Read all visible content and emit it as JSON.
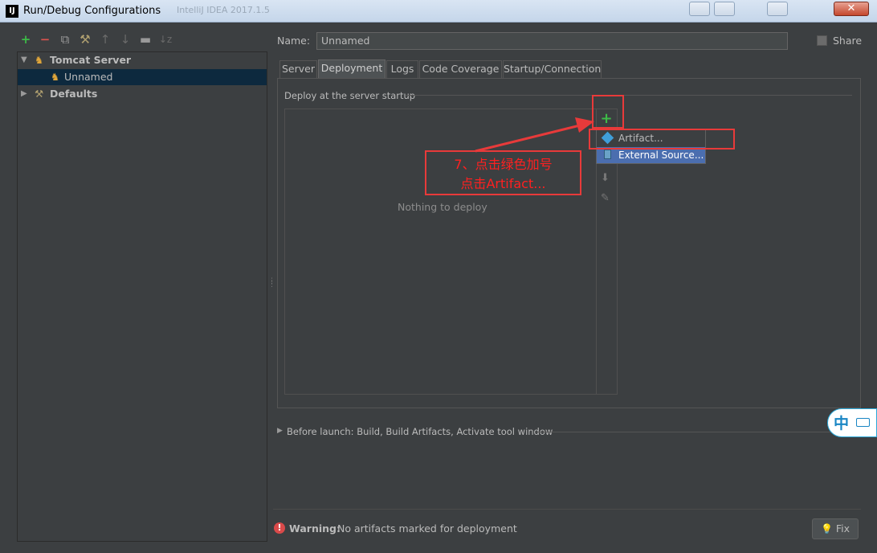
{
  "window": {
    "title": "Run/Debug Configurations",
    "app_icon": "IJ",
    "background_title": "IntelliJ IDEA 2017.1.5"
  },
  "toolbar": {
    "icons": [
      "add-icon",
      "remove-icon",
      "copy-icon",
      "edit-defaults-icon",
      "move-up-icon",
      "move-down-icon",
      "folder-icon",
      "sort-icon"
    ]
  },
  "tree": {
    "items": [
      {
        "label": "Tomcat Server",
        "expanded": true
      },
      {
        "label": "Unnamed",
        "selected": true
      },
      {
        "label": "Defaults",
        "expanded": false
      }
    ]
  },
  "form": {
    "name_label": "Name:",
    "name_value": "Unnamed",
    "share_label": "Share",
    "share_checked": false
  },
  "tabs": [
    {
      "label": "Server"
    },
    {
      "label": "Deployment",
      "active": true
    },
    {
      "label": "Logs"
    },
    {
      "label": "Code Coverage"
    },
    {
      "label": "Startup/Connection"
    }
  ],
  "deployment": {
    "section_title": "Deploy at the server startup",
    "empty_text": "Nothing to deploy"
  },
  "popup": {
    "items": [
      {
        "label": "Artifact..."
      },
      {
        "label": "External Source...",
        "selected": true
      }
    ]
  },
  "annotation": {
    "line1": "7、点击绿色加号",
    "line2": "点击Artifact...",
    "color": "#e83a3a"
  },
  "before_launch": {
    "text": "Before launch: Build, Build Artifacts, Activate tool window"
  },
  "warning": {
    "bold": "Warning:",
    "text": "No artifacts marked for deployment"
  },
  "fix_button": {
    "label": "Fix"
  },
  "ime": {
    "label": "中"
  }
}
